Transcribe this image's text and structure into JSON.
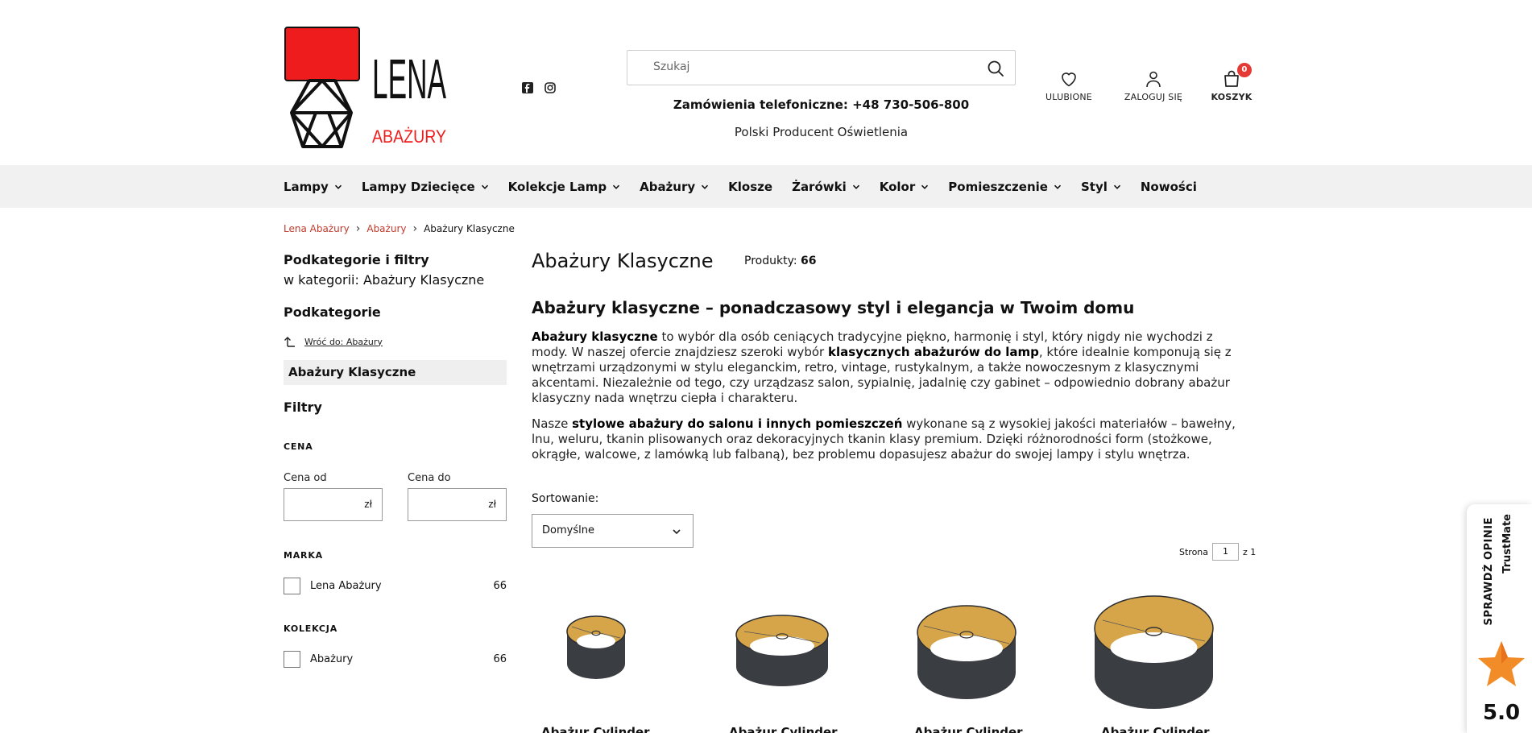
{
  "header": {
    "logo_text": "LENA",
    "logo_sub": "ABAŻURY",
    "search_placeholder": "Szukaj",
    "phone": "Zamówienia telefoniczne: +48 730-506-800",
    "producer": "Polski Producent Oświetlenia",
    "favorites_label": "ULUBIONE",
    "login_label": "ZALOGUJ SIĘ",
    "cart_label": "KOSZYK",
    "cart_count": "0"
  },
  "nav": [
    "Lampy",
    "Lampy Dziecięce",
    "Kolekcje Lamp",
    "Abażury",
    "Klosze",
    "Żarówki",
    "Kolor",
    "Pomieszczenie",
    "Styl",
    "Nowości"
  ],
  "breadcrumb": [
    "Lena Abażury",
    "Abażury",
    "Abażury Klasyczne"
  ],
  "sidebar": {
    "title": "Podkategorie i filtry",
    "subtitle": "w kategorii: Abażury Klasyczne",
    "subcat_title": "Podkategorie",
    "back_link": "Wróć do: Abażury",
    "active_cat": "Abażury Klasyczne",
    "filters_title": "Filtry",
    "price_title": "CENA",
    "price_from": "Cena od",
    "price_to": "Cena do",
    "currency": "zł",
    "brand_title": "MARKA",
    "brand_item": "Lena Abażury",
    "brand_count": "66",
    "collection_title": "KOLEKCJA",
    "collection_item": "Abażury",
    "collection_count": "66"
  },
  "main": {
    "title": "Abażury Klasyczne",
    "products_label": "Produkty:",
    "products_count": "66",
    "h2": "Abażury klasyczne – ponadczasowy styl i elegancja w Twoim domu",
    "p1_b1": "Abażury klasyczne",
    "p1_t1": " to wybór dla osób ceniących tradycyjne piękno, harmonię i styl, który nigdy nie wychodzi z mody. W naszej ofercie znajdziesz szeroki wybór ",
    "p1_b2": "klasycznych abażurów do lamp",
    "p1_t2": ", które idealnie komponują się z wnętrzami urządzonymi w stylu eleganckim, retro, vintage, rustykalnym, a także nowoczesnym z klasycznymi akcentami. Niezależnie od tego, czy urządzasz salon, sypialnię, jadalnię czy gabinet – odpowiednio dobrany abażur klasyczny nada wnętrzu ciepła i charakteru.",
    "p2_t1": "Nasze ",
    "p2_b1": "stylowe abażury do salonu i innych pomieszczeń",
    "p2_t2": " wykonane są z wysokiej jakości materiałów – bawełny, lnu, weluru, tkanin plisowanych oraz dekoracyjnych tkanin klasy premium. Dzięki różnorodności form (stożkowe, okrągłe, walcowe, z lamówką lub falbaną), bez problemu dopasujesz abażur do swojej lampy i stylu wnętrza.",
    "sort_label": "Sortowanie:",
    "sort_value": "Domyślne",
    "page_label": "Strona",
    "page_value": "1",
    "page_of": "z 1"
  },
  "products": [
    "Abażur Cylinder",
    "Abażur Cylinder",
    "Abażur Cylinder",
    "Abażur Cylinder"
  ],
  "trustmate": {
    "label": "SPRAWDŹ OPINIE",
    "brand": "TrustMate",
    "score": "5.0"
  },
  "colors": {
    "accent_red": "#e53935",
    "link_red": "#c0392b",
    "nav_bg": "#f1f1f1",
    "shade_dark": "#3a3d42",
    "shade_gold": "#d6a54a"
  }
}
